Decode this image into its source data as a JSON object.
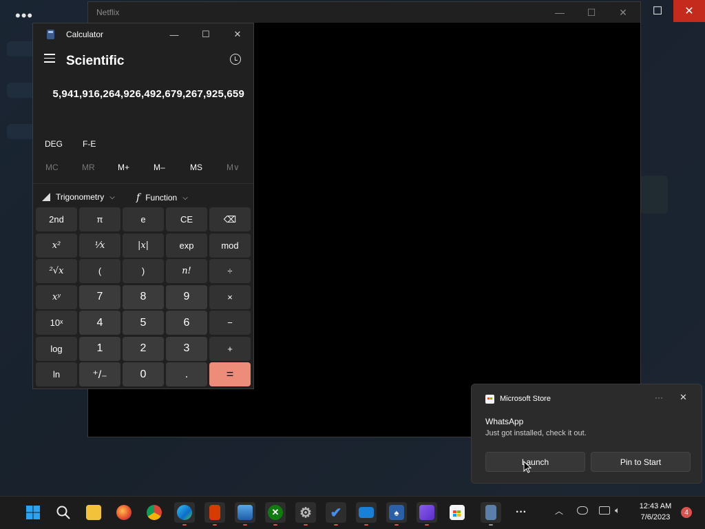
{
  "background_window": {
    "title": "Netflix"
  },
  "calculator": {
    "title": "Calculator",
    "mode": "Scientific",
    "display_value": "5,941,916,264,926,492,679,267,925,659",
    "angle_mode": "DEG",
    "fe_label": "F-E",
    "memory": [
      "MC",
      "MR",
      "M+",
      "M–",
      "MS",
      "M∨"
    ],
    "dropdowns": {
      "trigonometry": "Trigonometry",
      "function": "Function"
    },
    "keys": {
      "second": "2nd",
      "pi": "π",
      "e": "e",
      "ce": "CE",
      "backspace": "⌫",
      "x2": "x²",
      "reciprocal": "¹⁄x",
      "abs": "|x|",
      "exp": "exp",
      "mod": "mod",
      "sqrt": "²√x",
      "lparen": "(",
      "rparen": ")",
      "factorial": "n!",
      "divide": "÷",
      "xy": "xʸ",
      "seven": "7",
      "eight": "8",
      "nine": "9",
      "multiply": "×",
      "tenx": "10ˣ",
      "four": "4",
      "five": "5",
      "six": "6",
      "minus": "−",
      "log": "log",
      "one": "1",
      "two": "2",
      "three": "3",
      "plus": "+",
      "ln": "ln",
      "negate": "⁺/₋",
      "zero": "0",
      "decimal": ".",
      "equals": "="
    }
  },
  "toast": {
    "source": "Microsoft Store",
    "app_name": "WhatsApp",
    "message": "Just got installed, check it out.",
    "launch_label": "Launch",
    "pin_label": "Pin to Start"
  },
  "taskbar": {
    "time": "12:43 AM",
    "date": "7/6/2023",
    "notification_count": "4",
    "overflow_label": "···"
  },
  "top_overflow": "•••",
  "colors": {
    "equals_key": "#ee8c7a",
    "close_button": "#c42b1c",
    "taskbar_indicator": "#d9534f"
  }
}
